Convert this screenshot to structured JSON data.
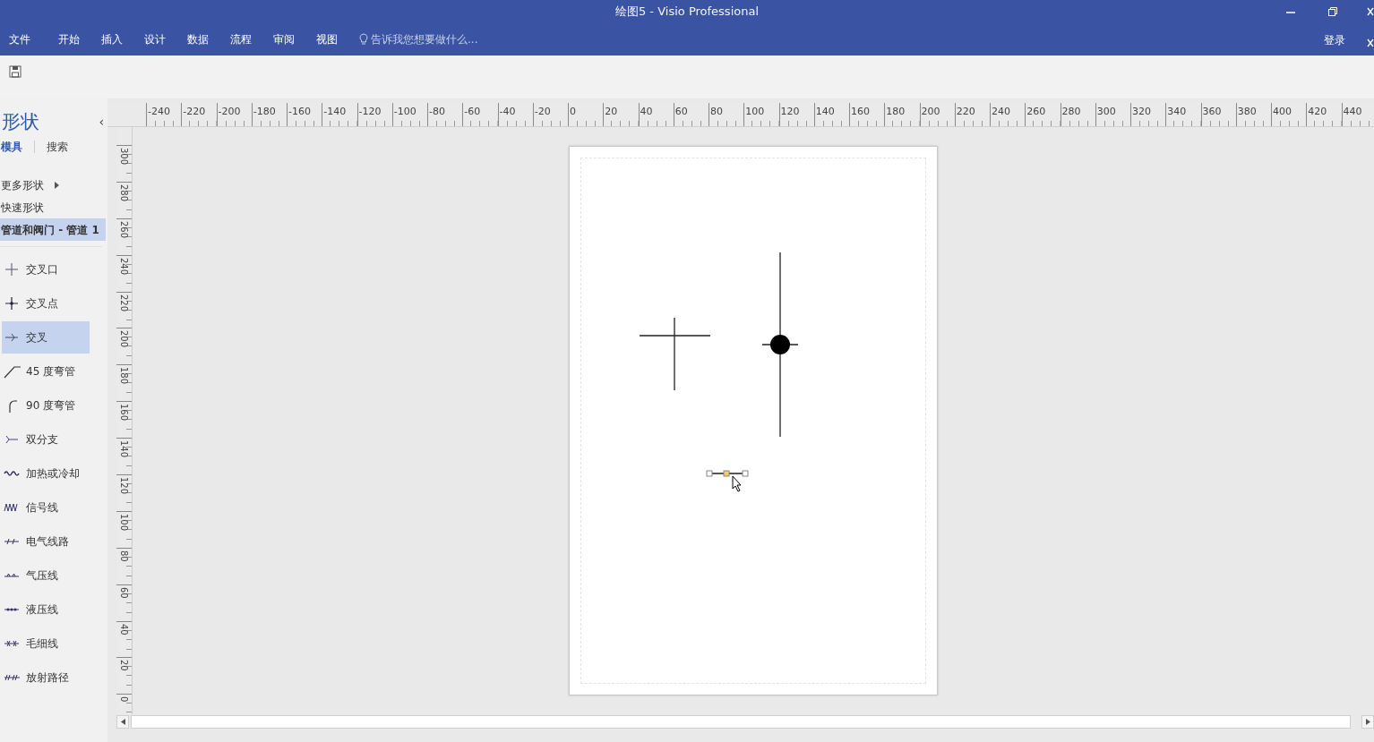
{
  "window": {
    "title": "绘图5 - Visio Professional"
  },
  "menu": {
    "items": [
      {
        "label": "文件"
      },
      {
        "label": "开始"
      },
      {
        "label": "插入"
      },
      {
        "label": "设计"
      },
      {
        "label": "数据"
      },
      {
        "label": "流程"
      },
      {
        "label": "审阅"
      },
      {
        "label": "视图"
      }
    ],
    "tell_me": {
      "placeholder": "告诉我您想要做什么..."
    },
    "sign_in": "登录"
  },
  "shapes_pane": {
    "title": "形状",
    "collapse": "‹",
    "tabs": [
      {
        "label": "模具",
        "selected": true
      },
      {
        "label": "搜索",
        "selected": false
      }
    ],
    "stencils": [
      {
        "label": "更多形状",
        "kind": "submenu",
        "selected": false
      },
      {
        "label": "快速形状",
        "kind": "plain",
        "selected": false
      },
      {
        "label": "管道和阀门 - 管道 1",
        "kind": "plain",
        "selected": true
      }
    ],
    "items": [
      {
        "label": "交叉口",
        "kind": "cross",
        "selected": false
      },
      {
        "label": "交叉点",
        "kind": "dotcross",
        "selected": false
      },
      {
        "label": "交叉",
        "kind": "arrow",
        "selected": true
      },
      {
        "label": "45 度弯管",
        "kind": "elbow45",
        "selected": false
      },
      {
        "label": "90 度弯管",
        "kind": "elbow90",
        "selected": false
      },
      {
        "label": "双分支",
        "kind": "branch",
        "selected": false
      },
      {
        "label": "加热或冷却",
        "kind": "wave",
        "selected": false
      },
      {
        "label": "信号线",
        "kind": "signal",
        "selected": false
      },
      {
        "label": "电气线路",
        "kind": "electric",
        "selected": false
      },
      {
        "label": "气压线",
        "kind": "pneumatic",
        "selected": false
      },
      {
        "label": "液压线",
        "kind": "hydraulic",
        "selected": false
      },
      {
        "label": "毛细线",
        "kind": "capillary",
        "selected": false
      },
      {
        "label": "放射路径",
        "kind": "radiation",
        "selected": false
      }
    ]
  },
  "ruler_horizontal": [
    "-240",
    "-220",
    "-200",
    "-180",
    "-160",
    "-140",
    "-120",
    "-100",
    "-80",
    "-60",
    "-40",
    "-20",
    "0",
    "20",
    "40",
    "60",
    "80",
    "100",
    "120",
    "140",
    "160",
    "180",
    "200",
    "220",
    "240",
    "260",
    "280",
    "300",
    "320",
    "340",
    "360",
    "380",
    "400",
    "420",
    "440"
  ],
  "ruler_vertical": [
    "300",
    "280",
    "260",
    "240",
    "220",
    "200",
    "180",
    "160",
    "140",
    "120",
    "100",
    "80",
    "60",
    "40",
    "20",
    "0"
  ],
  "drawing_page": {
    "shapes": [
      {
        "kind": "cross",
        "selected": false
      },
      {
        "kind": "dotcross",
        "selected": false
      },
      {
        "kind": "connector",
        "selected": true
      }
    ]
  }
}
